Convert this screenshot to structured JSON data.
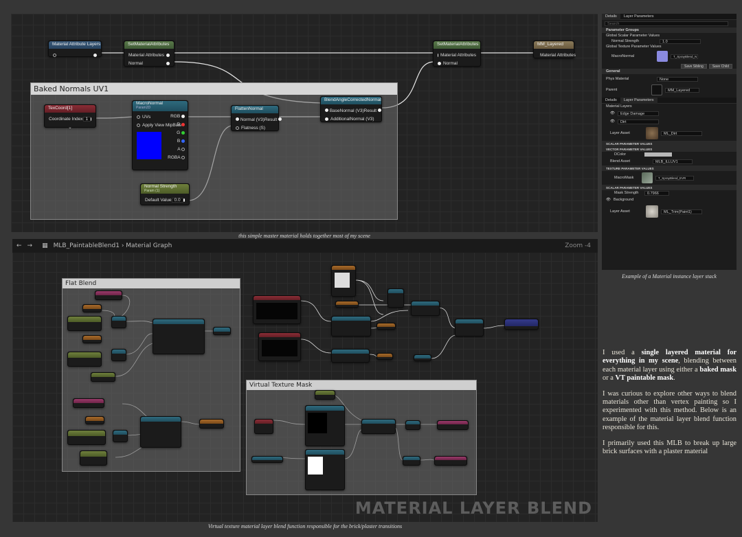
{
  "graph_top": {
    "nodes": {
      "mat_attr_layers": "Material Attribute Layers",
      "set_attr_1": "SetMaterialAttributes",
      "set_attr_1_pins": [
        "Material Attributes",
        "Normal"
      ],
      "set_attr_2": "SetMaterialAttributes",
      "set_attr_2_pins": [
        "Material Attributes",
        "Normal"
      ],
      "output": "MM_Layered",
      "output_pin": "Material Attributes"
    },
    "comment": "Baked Normals UV1",
    "texcoord": {
      "title": "TexCoord[1]",
      "label": "Coordinate Index",
      "value": "1"
    },
    "macro": {
      "title": "MacroNormal",
      "subtitle": "Param2D",
      "pins_in": [
        "UVs",
        "Apply View MipBias"
      ],
      "pins_out": [
        "RGB",
        "R",
        "G",
        "B",
        "A",
        "RGBA"
      ]
    },
    "flatten": {
      "title": "FlattenNormal",
      "pins": [
        "Normal (V3)",
        "Flatness (S)"
      ],
      "result": "Result"
    },
    "blend": {
      "title": "BlendAngleCorrectedNormals",
      "pins": [
        "BaseNormal (V3)",
        "AdditionalNormal (V3)"
      ],
      "result": "Result"
    },
    "strength": {
      "title": "Normal Strength",
      "subtitle": "Param (1)",
      "label": "Default Value",
      "value": "0.0"
    }
  },
  "caption_top": "this simple master material holds together most of my scene",
  "graph_bottom": {
    "breadcrumb_a": "MLB_PaintableBlend1",
    "breadcrumb_b": "Material Graph",
    "zoom": "Zoom -4",
    "comment_a": "Flat Blend",
    "comment_b": "Virtual Texture Mask",
    "watermark": "MATERIAL LAYER BLEND"
  },
  "caption_bottom": "Virtual texture material layer blend function responsible for the brick/plaster transitions",
  "panel": {
    "tabs": [
      "Details",
      "Layer Parameters"
    ],
    "search": "Search",
    "parameter_groups": "Parameter Groups",
    "scalar_group": "Global Scalar Parameter Values",
    "normal_strength": "Normal Strength",
    "normal_strength_value": "1.0",
    "texture_group": "Global Texture Parameter Values",
    "macro_normal": "MacroNormal",
    "macro_texture": "T_SprayBlend_N",
    "btn_save_sibling": "Save Sibling",
    "btn_save_child": "Save Child",
    "general": "General",
    "phys_material": "Phys Material",
    "phys_value": "None",
    "parent": "Parent",
    "parent_value": "MM_Layered",
    "tabs2": [
      "Details",
      "Layer Parameters"
    ],
    "material_layers": "Material Layers",
    "layer_edge_damage": "Edge Damage",
    "layer_dirt": "Dirt",
    "layer_asset": "Layer Asset",
    "layer_asset_value": "ML_Dirt",
    "scalar_values": "SCALAR PARAMETER VALUES",
    "vector_values": "VECTOR PARAMETER VALUES",
    "color_label": "DColor",
    "blend_asset": "Blend Asset",
    "blend_asset_value": "MLB_ILLUV1",
    "texture_values": "TEXTURE PARAMETER VALUES",
    "mask_label": "MacroMask",
    "mask_texture": "T_SprayBlend_EVR",
    "scalar_values2": "SCALAR PARAMETER VALUES",
    "mask_strength": "Mask Strength",
    "mask_strength_value": "0.7966",
    "background": "Background",
    "bg_layer_asset": "Layer Asset",
    "bg_layer_value": "ML_Trim(Paint1)",
    "colors": {
      "mask_swatch": "#b8b8b8"
    }
  },
  "caption_panel": "Example of a Material instance layer stack",
  "description": {
    "p1_a": "I used a ",
    "p1_b": "single layered material for everything in my scene",
    "p1_c": ", blending between each material layer using either a ",
    "p1_d": "baked mask",
    "p1_e": " or a ",
    "p1_f": "VT paintable mask",
    "p1_g": ".",
    "p2": "I was curious to explore other ways to blend materials other than vertex painting so I experimented with this method. Below is an example of the material layer blend function responsible for this.",
    "p3": "I primarily used this MLB to break up large brick surfaces with a plaster material"
  }
}
